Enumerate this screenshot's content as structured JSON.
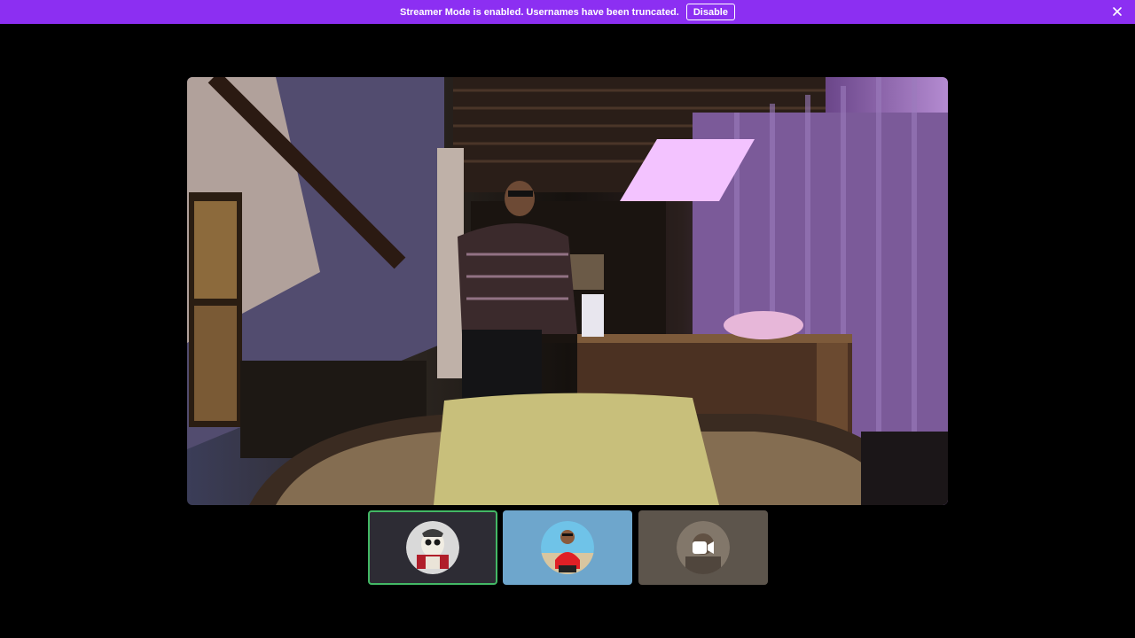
{
  "banner": {
    "message": "Streamer Mode is enabled. Usernames have been truncated.",
    "disable_label": "Disable",
    "background": "#8c2ff2",
    "close_icon": "close-icon"
  },
  "main_stream": {
    "description_icon": "video-feed"
  },
  "participants": [
    {
      "avatar": "skull-avatar",
      "active": true,
      "border_color": "#43b865"
    },
    {
      "avatar": "person-red-shirt-avatar",
      "active": false,
      "background": "#6ea6cc"
    },
    {
      "avatar": "camera-icon",
      "active": false,
      "background": "#5d554c",
      "video_on": true
    }
  ]
}
